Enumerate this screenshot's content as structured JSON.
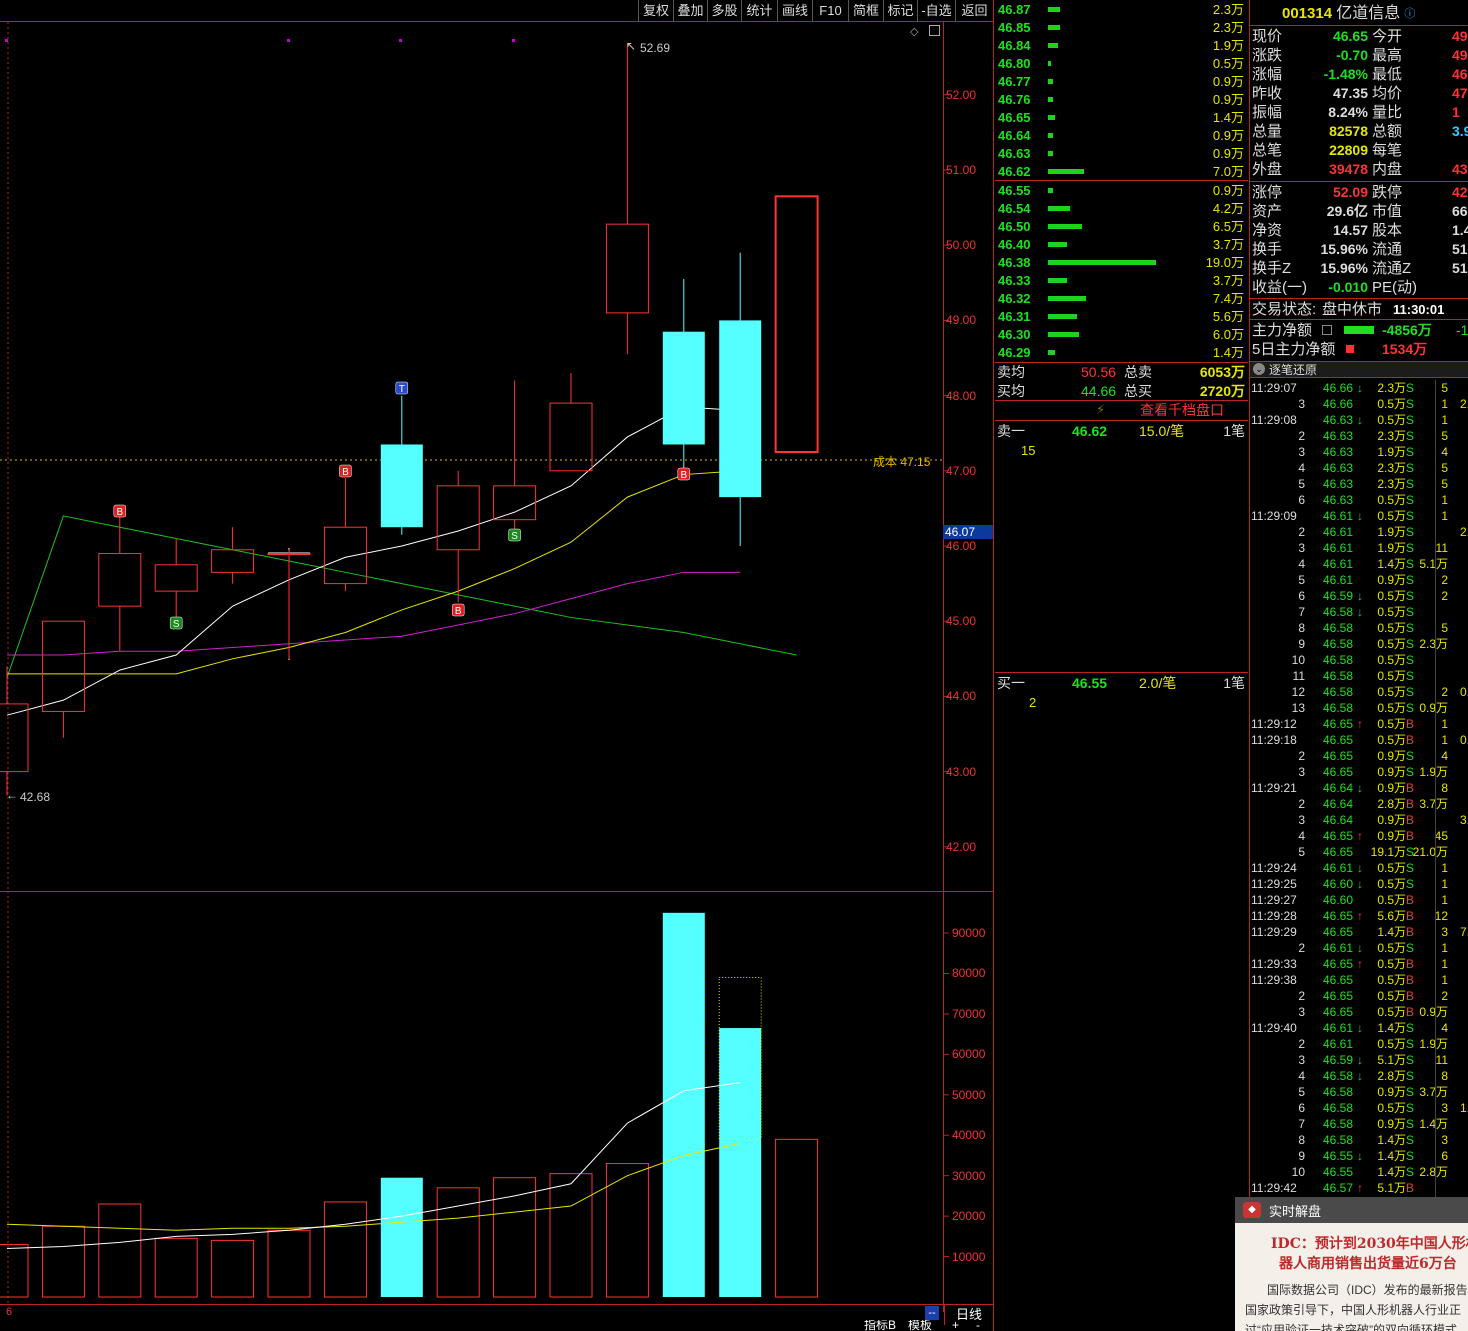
{
  "toolbar": {
    "buttons": [
      "复权",
      "叠加",
      "多股",
      "统计",
      "画线",
      "F10",
      "简框",
      "标记",
      "-自选",
      "返回"
    ]
  },
  "chart": {
    "price_ticks": [
      "52.00",
      "51.00",
      "50.00",
      "49.00",
      "48.00",
      "47.00",
      "46.00",
      "45.00",
      "44.00",
      "43.00",
      "42.00"
    ],
    "current_price_label": "46.07",
    "high_label": "52.69",
    "low_label": "42.68",
    "cost_label": "成本 47.15",
    "volume_ticks": [
      "90000",
      "80000",
      "70000",
      "60000",
      "50000",
      "40000",
      "30000",
      "20000",
      "10000"
    ],
    "period_label": "日线",
    "left_bottom_label": "6",
    "bottom_tabs": [
      "指标B",
      "模板",
      "+",
      "-"
    ],
    "candles": [
      {
        "o": 43.0,
        "c": 43.9,
        "h": 44.4,
        "l": 42.68,
        "up": true
      },
      {
        "o": 43.8,
        "c": 45.0,
        "h": 45.0,
        "l": 43.45,
        "up": true
      },
      {
        "o": 45.2,
        "c": 45.9,
        "h": 46.4,
        "l": 44.6,
        "up": true
      },
      {
        "o": 45.4,
        "c": 45.75,
        "h": 46.1,
        "l": 45.0,
        "up": true
      },
      {
        "o": 45.65,
        "c": 45.95,
        "h": 46.25,
        "l": 45.5,
        "up": true
      },
      {
        "o": 45.9,
        "c": 45.9,
        "h": 45.95,
        "l": 44.5,
        "up": true
      },
      {
        "o": 45.5,
        "c": 46.25,
        "h": 46.9,
        "l": 45.4,
        "up": true
      },
      {
        "o": 47.35,
        "c": 46.25,
        "h": 48.0,
        "l": 46.15,
        "up": false
      },
      {
        "o": 45.95,
        "c": 46.8,
        "h": 47.0,
        "l": 45.25,
        "up": true
      },
      {
        "o": 46.35,
        "c": 46.8,
        "h": 48.2,
        "l": 46.2,
        "up": true
      },
      {
        "o": 47.0,
        "c": 47.9,
        "h": 48.3,
        "l": 47.0,
        "up": true
      },
      {
        "o": 49.1,
        "c": 50.28,
        "h": 52.69,
        "l": 48.55,
        "up": true
      },
      {
        "o": 48.85,
        "c": 47.35,
        "h": 49.55,
        "l": 47.0,
        "up": false
      },
      {
        "o": 49.0,
        "c": 46.65,
        "h": 49.9,
        "l": 46.0,
        "up": false
      },
      {
        "o": 47.25,
        "c": 50.65,
        "h": 50.65,
        "l": 47.25,
        "up": true
      }
    ],
    "volumes": [
      13000,
      17500,
      23000,
      14500,
      14000,
      16500,
      23500,
      29500,
      27000,
      29500,
      30500,
      33000,
      95000,
      66500,
      39000
    ],
    "markers": [
      {
        "i": 2,
        "text": "B",
        "type": "buy"
      },
      {
        "i": 3,
        "text": "S",
        "type": "sell"
      },
      {
        "i": 6,
        "text": "B",
        "type": "buy"
      },
      {
        "i": 7,
        "text": "T",
        "type": "t"
      },
      {
        "i": 8,
        "text": "B",
        "type": "buy"
      },
      {
        "i": 9,
        "text": "S",
        "type": "sell"
      },
      {
        "i": 12,
        "text": "B",
        "type": "buy"
      }
    ],
    "ma_white": [
      43.75,
      43.95,
      44.35,
      44.55,
      45.2,
      45.55,
      45.85,
      46.0,
      46.2,
      46.45,
      46.8,
      47.45,
      47.85,
      47.8
    ],
    "ma_yellow": [
      44.3,
      44.3,
      44.3,
      44.3,
      44.5,
      44.65,
      44.85,
      45.15,
      45.4,
      45.7,
      46.05,
      46.65,
      46.95,
      47.0
    ],
    "ma_magenta": [
      44.55,
      44.55,
      44.6,
      44.6,
      44.65,
      44.7,
      44.75,
      44.8,
      44.95,
      45.1,
      45.3,
      45.5,
      45.65,
      45.65
    ],
    "ma_green": [
      46.4,
      46.25,
      46.1,
      45.95,
      45.8,
      45.65,
      45.5,
      45.35,
      45.2,
      45.05,
      44.95,
      44.85,
      44.7,
      44.55
    ],
    "vol_ma_white": [
      12000,
      12500,
      13500,
      15000,
      15500,
      16500,
      18000,
      20000,
      22500,
      25000,
      28000,
      43000,
      51000,
      53000
    ],
    "vol_ma_yellow": [
      18000,
      17500,
      17000,
      16500,
      17000,
      17000,
      17500,
      18500,
      19500,
      21000,
      22500,
      30000,
      35000,
      38000
    ]
  },
  "orderbook": {
    "asks": [
      {
        "p": "46.87",
        "v": "2.3万",
        "w": 12
      },
      {
        "p": "46.85",
        "v": "2.3万",
        "w": 12
      },
      {
        "p": "46.84",
        "v": "1.9万",
        "w": 10
      },
      {
        "p": "46.80",
        "v": "0.5万",
        "w": 3
      },
      {
        "p": "46.77",
        "v": "0.9万",
        "w": 5
      },
      {
        "p": "46.76",
        "v": "0.9万",
        "w": 5
      },
      {
        "p": "46.65",
        "v": "1.4万",
        "w": 7
      },
      {
        "p": "46.64",
        "v": "0.9万",
        "w": 5
      },
      {
        "p": "46.63",
        "v": "0.9万",
        "w": 5
      },
      {
        "p": "46.62",
        "v": "7.0万",
        "w": 36
      }
    ],
    "bids": [
      {
        "p": "46.55",
        "v": "0.9万",
        "w": 5
      },
      {
        "p": "46.54",
        "v": "4.2万",
        "w": 22
      },
      {
        "p": "46.50",
        "v": "6.5万",
        "w": 34
      },
      {
        "p": "46.40",
        "v": "3.7万",
        "w": 19
      },
      {
        "p": "46.38",
        "v": "19.0万",
        "w": 108
      },
      {
        "p": "46.33",
        "v": "3.7万",
        "w": 19
      },
      {
        "p": "46.32",
        "v": "7.4万",
        "w": 38
      },
      {
        "p": "46.31",
        "v": "5.6万",
        "w": 29
      },
      {
        "p": "46.30",
        "v": "6.0万",
        "w": 31
      },
      {
        "p": "46.29",
        "v": "1.4万",
        "w": 7
      }
    ],
    "sell_avg_label": "卖均",
    "sell_avg": "50.56",
    "sell_total_label": "总卖",
    "sell_total": "6053万",
    "buy_avg_label": "买均",
    "buy_avg": "44.66",
    "buy_total_label": "总买",
    "buy_total": "2720万",
    "view_link": "查看千档盘口",
    "ask1_label": "卖一",
    "ask1_price": "46.62",
    "ask1_vol": "15.0/笔",
    "ask1_count": "1笔",
    "ask1_detail": "15",
    "bid1_label": "买一",
    "bid1_price": "46.55",
    "bid1_vol": "2.0/笔",
    "bid1_count": "1笔",
    "bid1_detail": "2"
  },
  "stock": {
    "code": "001314",
    "name": "亿道信息"
  },
  "info": {
    "rows": [
      [
        "现价",
        "46.65",
        "今开",
        "49"
      ],
      [
        "涨跌",
        "-0.70",
        "最高",
        "49"
      ],
      [
        "涨幅",
        "-1.48%",
        "最低",
        "46"
      ],
      [
        "昨收",
        "47.35",
        "均价",
        "47"
      ],
      [
        "振幅",
        "8.24%",
        "量比",
        "1"
      ],
      [
        "总量",
        "82578",
        "总额",
        "3.93"
      ],
      [
        "总笔",
        "22809",
        "每笔",
        ""
      ],
      [
        "外盘",
        "39478",
        "内盘",
        "431"
      ]
    ],
    "rows2": [
      [
        "涨停",
        "52.09",
        "跌停",
        "42"
      ],
      [
        "资产",
        "29.6亿",
        "市值",
        "66.0"
      ],
      [
        "净资",
        "14.57",
        "股本",
        "1.41"
      ],
      [
        "换手",
        "15.96%",
        "流通",
        "5175"
      ],
      [
        "换手Z",
        "15.96%",
        "流通Z",
        "5175"
      ],
      [
        "收益(一)",
        "-0.010",
        "PE(动)",
        ""
      ]
    ],
    "status_label": "交易状态:",
    "status": "盘中休市",
    "status_time": "11:30:01",
    "flow_label": "主力净额",
    "flow_value": "-4856万",
    "flow_extra": "-1",
    "flow5_label": "5日主力净额",
    "flow5_value": "1534万"
  },
  "ticks": {
    "header": "逐笔还原",
    "rows": [
      {
        "t": "11:29:07",
        "p": "46.66",
        "a": "↓",
        "v": "2.3万",
        "s": "S",
        "n": "5",
        "x": ""
      },
      {
        "t": "3",
        "p": "46.66",
        "a": "",
        "v": "0.5万",
        "s": "S",
        "n": "1",
        "x": "2."
      },
      {
        "t": "11:29:08",
        "p": "46.63",
        "a": "↓",
        "v": "0.5万",
        "s": "S",
        "n": "1",
        "x": ""
      },
      {
        "t": "2",
        "p": "46.63",
        "a": "",
        "v": "2.3万",
        "s": "S",
        "n": "5",
        "x": ""
      },
      {
        "t": "3",
        "p": "46.63",
        "a": "",
        "v": "1.9万",
        "s": "S",
        "n": "4",
        "x": ""
      },
      {
        "t": "4",
        "p": "46.63",
        "a": "",
        "v": "2.3万",
        "s": "S",
        "n": "5",
        "x": ""
      },
      {
        "t": "5",
        "p": "46.63",
        "a": "",
        "v": "2.3万",
        "s": "S",
        "n": "5",
        "x": ""
      },
      {
        "t": "6",
        "p": "46.63",
        "a": "",
        "v": "0.5万",
        "s": "S",
        "n": "1",
        "x": ""
      },
      {
        "t": "11:29:09",
        "p": "46.61",
        "a": "↓",
        "v": "0.5万",
        "s": "S",
        "n": "1",
        "x": ""
      },
      {
        "t": "2",
        "p": "46.61",
        "a": "",
        "v": "1.9万",
        "s": "S",
        "n": "",
        "x": "2."
      },
      {
        "t": "3",
        "p": "46.61",
        "a": "",
        "v": "1.9万",
        "s": "S",
        "n": "11",
        "x": ""
      },
      {
        "t": "4",
        "p": "46.61",
        "a": "",
        "v": "1.4万",
        "s": "S",
        "n": "5.1万",
        "x": ""
      },
      {
        "t": "5",
        "p": "46.61",
        "a": "",
        "v": "0.9万",
        "s": "S",
        "n": "2",
        "x": ""
      },
      {
        "t": "6",
        "p": "46.59",
        "a": "↓",
        "v": "0.5万",
        "s": "S",
        "n": "2",
        "x": ""
      },
      {
        "t": "7",
        "p": "46.58",
        "a": "↓",
        "v": "0.5万",
        "s": "S",
        "n": "",
        "x": ""
      },
      {
        "t": "8",
        "p": "46.58",
        "a": "",
        "v": "0.5万",
        "s": "S",
        "n": "5",
        "x": ""
      },
      {
        "t": "9",
        "p": "46.58",
        "a": "",
        "v": "0.5万",
        "s": "S",
        "n": "2.3万",
        "x": ""
      },
      {
        "t": "10",
        "p": "46.58",
        "a": "",
        "v": "0.5万",
        "s": "S",
        "n": "",
        "x": ""
      },
      {
        "t": "11",
        "p": "46.58",
        "a": "",
        "v": "0.5万",
        "s": "S",
        "n": "",
        "x": ""
      },
      {
        "t": "12",
        "p": "46.58",
        "a": "",
        "v": "0.5万",
        "s": "S",
        "n": "2",
        "x": "0."
      },
      {
        "t": "13",
        "p": "46.58",
        "a": "",
        "v": "0.5万",
        "s": "S",
        "n": "0.9万",
        "x": ""
      },
      {
        "t": "11:29:12",
        "p": "46.65",
        "a": "↑",
        "v": "0.5万",
        "s": "B",
        "n": "1",
        "x": ""
      },
      {
        "t": "11:29:18",
        "p": "46.65",
        "a": "",
        "v": "0.5万",
        "s": "B",
        "n": "1",
        "x": "0."
      },
      {
        "t": "2",
        "p": "46.65",
        "a": "",
        "v": "0.9万",
        "s": "S",
        "n": "4",
        "x": ""
      },
      {
        "t": "3",
        "p": "46.65",
        "a": "",
        "v": "0.9万",
        "s": "S",
        "n": "1.9万",
        "x": ""
      },
      {
        "t": "11:29:21",
        "p": "46.64",
        "a": "↓",
        "v": "0.9万",
        "s": "B",
        "n": "8",
        "x": ""
      },
      {
        "t": "2",
        "p": "46.64",
        "a": "",
        "v": "2.8万",
        "s": "B",
        "n": "3.7万",
        "x": ""
      },
      {
        "t": "3",
        "p": "46.64",
        "a": "",
        "v": "0.9万",
        "s": "B",
        "n": "",
        "x": "3."
      },
      {
        "t": "4",
        "p": "46.65",
        "a": "↑",
        "v": "0.9万",
        "s": "B",
        "n": "45",
        "x": ""
      },
      {
        "t": "5",
        "p": "46.65",
        "a": "",
        "v": "19.1万",
        "s": "S",
        "n": "21.0万",
        "x": ""
      },
      {
        "t": "11:29:24",
        "p": "46.61",
        "a": "↓",
        "v": "0.5万",
        "s": "S",
        "n": "1",
        "x": ""
      },
      {
        "t": "11:29:25",
        "p": "46.60",
        "a": "↓",
        "v": "0.5万",
        "s": "S",
        "n": "1",
        "x": ""
      },
      {
        "t": "11:29:27",
        "p": "46.60",
        "a": "",
        "v": "0.5万",
        "s": "B",
        "n": "1",
        "x": ""
      },
      {
        "t": "11:29:28",
        "p": "46.65",
        "a": "↑",
        "v": "5.6万",
        "s": "B",
        "n": "12",
        "x": ""
      },
      {
        "t": "11:29:29",
        "p": "46.65",
        "a": "",
        "v": "1.4万",
        "s": "B",
        "n": "3",
        "x": "7."
      },
      {
        "t": "2",
        "p": "46.61",
        "a": "↓",
        "v": "0.5万",
        "s": "S",
        "n": "1",
        "x": ""
      },
      {
        "t": "11:29:33",
        "p": "46.65",
        "a": "↑",
        "v": "0.5万",
        "s": "B",
        "n": "1",
        "x": ""
      },
      {
        "t": "11:29:38",
        "p": "46.65",
        "a": "",
        "v": "0.5万",
        "s": "B",
        "n": "1",
        "x": ""
      },
      {
        "t": "2",
        "p": "46.65",
        "a": "",
        "v": "0.5万",
        "s": "B",
        "n": "2",
        "x": ""
      },
      {
        "t": "3",
        "p": "46.65",
        "a": "",
        "v": "0.5万",
        "s": "B",
        "n": "0.9万",
        "x": ""
      },
      {
        "t": "11:29:40",
        "p": "46.61",
        "a": "↓",
        "v": "1.4万",
        "s": "S",
        "n": "4",
        "x": ""
      },
      {
        "t": "2",
        "p": "46.61",
        "a": "",
        "v": "0.5万",
        "s": "S",
        "n": "1.9万",
        "x": ""
      },
      {
        "t": "3",
        "p": "46.59",
        "a": "↓",
        "v": "5.1万",
        "s": "S",
        "n": "11",
        "x": ""
      },
      {
        "t": "4",
        "p": "46.58",
        "a": "↓",
        "v": "2.8万",
        "s": "S",
        "n": "8",
        "x": ""
      },
      {
        "t": "5",
        "p": "46.58",
        "a": "",
        "v": "0.9万",
        "s": "S",
        "n": "3.7万",
        "x": ""
      },
      {
        "t": "6",
        "p": "46.58",
        "a": "",
        "v": "0.5万",
        "s": "S",
        "n": "3",
        "x": "1."
      },
      {
        "t": "7",
        "p": "46.58",
        "a": "",
        "v": "0.9万",
        "s": "S",
        "n": "1.4万",
        "x": ""
      },
      {
        "t": "8",
        "p": "46.58",
        "a": "",
        "v": "1.4万",
        "s": "S",
        "n": "3",
        "x": ""
      },
      {
        "t": "9",
        "p": "46.55",
        "a": "↓",
        "v": "1.4万",
        "s": "S",
        "n": "6",
        "x": ""
      },
      {
        "t": "10",
        "p": "46.55",
        "a": "",
        "v": "1.4万",
        "s": "S",
        "n": "2.8万",
        "x": ""
      },
      {
        "t": "11:29:42",
        "p": "46.57",
        "a": "↑",
        "v": "5.1万",
        "s": "B",
        "n": "",
        "x": ""
      }
    ]
  },
  "news": {
    "header": "实时解盘",
    "title": "IDC：预计到2030年中国人形机器人商用销售出货量近6万台",
    "title_line1": "IDC：预计到2030年中国人形机",
    "title_line2": "器人商用销售出货量近6万台",
    "body_line1": "国际数据公司（IDC）发布的最新报告",
    "body_line2": "国家政策引导下，中国人形机器人行业正",
    "body_line3": "过“应用验证一技术突破”的双向循环模式"
  },
  "colors": {
    "up": "#ff3333",
    "down": "#54ffff",
    "green": "#1ee01e",
    "yellow": "#e6e600",
    "bg": "#000000"
  }
}
